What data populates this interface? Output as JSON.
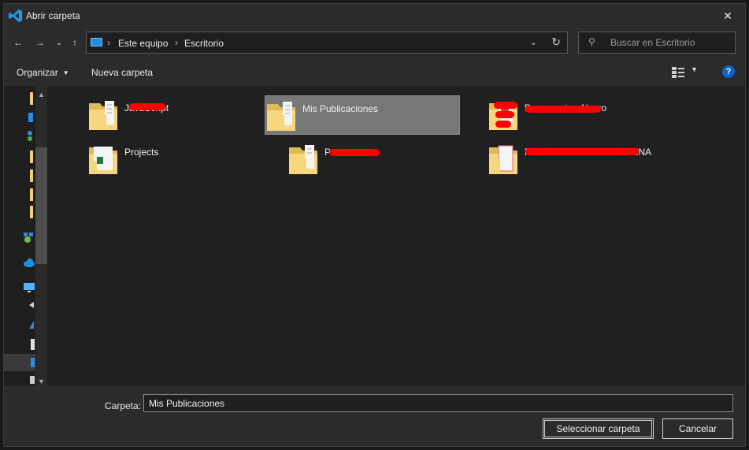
{
  "window": {
    "title": "Abrir carpeta",
    "close": "✕"
  },
  "nav": {
    "back": "←",
    "forward": "→",
    "history": "⌄",
    "up": "↑",
    "breadcrumb": [
      "Este equipo",
      "Escritorio"
    ],
    "dropdown": "⌄",
    "refresh": "↻"
  },
  "search": {
    "placeholder": "Buscar en Escritorio",
    "icon": "⚲"
  },
  "toolbar": {
    "organize": "Organizar",
    "organize_caret": "▼",
    "new_folder": "Nueva carpeta",
    "view_caret": "▼",
    "help": "?"
  },
  "sidebar": {
    "scroll_up": "▲",
    "scroll_down": "▼"
  },
  "files": [
    {
      "name": "JavaScript",
      "icon": "folder"
    },
    {
      "name": "Mis Publicaciones",
      "icon": "folder"
    },
    {
      "name": "Documentos Alvaro",
      "icon": "folder-pdf"
    },
    {
      "name": "Projects",
      "icon": "folder-excel"
    },
    {
      "name": "P",
      "icon": "folder"
    },
    {
      "name": "PROYECTOS CUARENTENA",
      "icon": "folder-doc"
    }
  ],
  "footer": {
    "folder_label": "Carpeta:",
    "folder_value": "Mis Publicaciones",
    "select_button": "Seleccionar carpeta",
    "cancel_button": "Cancelar"
  },
  "colors": {
    "accent": "#0a63c9",
    "selected_tile": "#777777",
    "redaction": "#ff0000"
  }
}
